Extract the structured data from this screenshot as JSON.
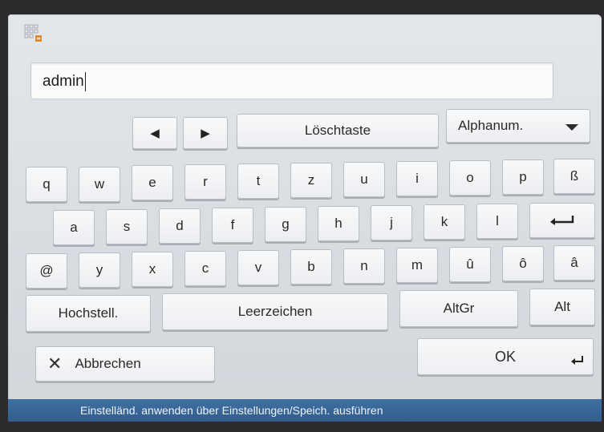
{
  "input": {
    "value": "admin"
  },
  "toolbar": {
    "left_icon": "triangle-left-icon",
    "right_icon": "triangle-right-icon",
    "backspace_label": "Löschtaste",
    "mode_label": "Alphanum."
  },
  "keyboard": {
    "row1": [
      "q",
      "w",
      "e",
      "r",
      "t",
      "z",
      "u",
      "i",
      "o",
      "p",
      "ß"
    ],
    "row2": [
      "a",
      "s",
      "d",
      "f",
      "g",
      "h",
      "j",
      "k",
      "l"
    ],
    "row3": [
      "@",
      "y",
      "x",
      "c",
      "v",
      "b",
      "n",
      "m",
      "û",
      "ô",
      "â"
    ],
    "enter_icon": "enter-arrow-icon",
    "shift_label": "Hochstell.",
    "space_label": "Leerzeichen",
    "altgr_label": "AltGr",
    "alt_label": "Alt"
  },
  "actions": {
    "cancel_label": "Abbrechen",
    "ok_label": "OK"
  },
  "status": {
    "text": "Einstelländ. anwenden über Einstellungen/Speich. ausführen"
  }
}
